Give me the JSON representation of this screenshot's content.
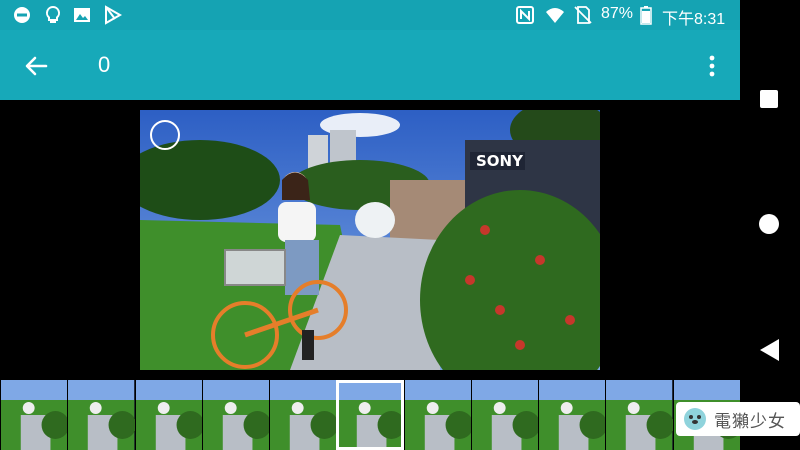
{
  "status_bar": {
    "battery": "87%",
    "time": "下午8:31",
    "left_icons": [
      "dnd-icon",
      "bulb-icon",
      "image-icon",
      "play-store-icon"
    ],
    "right_icons": [
      "nfc-icon",
      "wifi-icon",
      "no-sim-icon",
      "battery-icon"
    ]
  },
  "app_bar": {
    "title": "0",
    "back_icon": "arrow-left-icon",
    "menu_icon": "more-vert-icon"
  },
  "nav_bar": {
    "buttons": [
      "recents-button",
      "home-button",
      "back-button"
    ]
  },
  "photo": {
    "sign_text": "SONY"
  },
  "filmstrip": {
    "count": 11,
    "selected_index": 5
  },
  "watermark": {
    "text": "電獺少女"
  },
  "colors": {
    "accent": "#17a9b9",
    "statusbar": "#15a3b3"
  }
}
